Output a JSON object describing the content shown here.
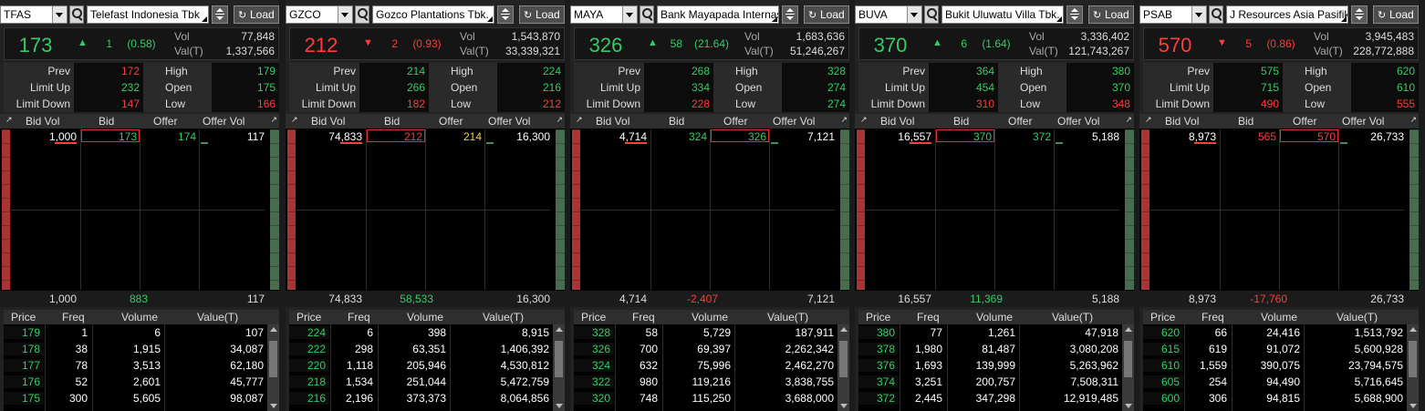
{
  "colors": {
    "up": "#33cc66",
    "down": "#ff3b3b",
    "same": "#e8d040",
    "neutral": "#ffffff",
    "label": "#aaaaaa"
  },
  "labels": {
    "load": "Load",
    "vol": "Vol",
    "val": "Val(T)",
    "prev": "Prev",
    "high": "High",
    "limit_up": "Limit Up",
    "open": "Open",
    "limit_down": "Limit Down",
    "low": "Low",
    "bid_vol": "Bid Vol",
    "bid": "Bid",
    "offer": "Offer",
    "offer_vol": "Offer Vol",
    "price": "Price",
    "freq": "Freq",
    "volume": "Volume",
    "value": "Value(T)"
  },
  "icons": {
    "search": "search-icon",
    "load": "refresh-icon",
    "expand": "expand-collapse-icon",
    "dropdown": "chevron-down-icon",
    "resize": "resize-icon"
  },
  "panels": [
    {
      "code": "TFAS",
      "name": "Telefast Indonesia Tbk",
      "direction": "up",
      "last": "173",
      "change": "1",
      "pct": "(0.58)",
      "vol": "77,848",
      "val": "1,337,566",
      "prev": "172",
      "high": "179",
      "limit_up": "232",
      "open": "175",
      "limit_down": "147",
      "low": "166",
      "prev_dir": "down",
      "high_dir": "up",
      "lu_dir": "up",
      "open_dir": "up",
      "ld_dir": "down",
      "low_dir": "down",
      "bid_vol": "1,000",
      "bid": "173",
      "offer": "174",
      "offer_vol": "117",
      "bid_dir": "up",
      "offer_dir": "up",
      "tot_bid": "1,000",
      "tot_diff": "883",
      "tot_offer": "117",
      "diff_dir": "up",
      "trades": [
        {
          "p": "179",
          "f": "1",
          "v": "6",
          "t": "107"
        },
        {
          "p": "178",
          "f": "38",
          "v": "1,915",
          "t": "34,087"
        },
        {
          "p": "177",
          "f": "78",
          "v": "3,513",
          "t": "62,180"
        },
        {
          "p": "176",
          "f": "52",
          "v": "2,601",
          "t": "45,777"
        },
        {
          "p": "175",
          "f": "300",
          "v": "5,605",
          "t": "98,087"
        }
      ],
      "trade_dirs": [
        "up",
        "up",
        "up",
        "up",
        "up"
      ]
    },
    {
      "code": "GZCO",
      "name": "Gozco Plantations Tbk.",
      "direction": "down",
      "last": "212",
      "change": "2",
      "pct": "(0.93)",
      "vol": "1,543,870",
      "val": "33,339,321",
      "prev": "214",
      "high": "224",
      "limit_up": "266",
      "open": "216",
      "limit_down": "182",
      "low": "212",
      "prev_dir": "up",
      "high_dir": "up",
      "lu_dir": "up",
      "open_dir": "up",
      "ld_dir": "down",
      "low_dir": "down",
      "bid_vol": "74,833",
      "bid": "212",
      "offer": "214",
      "offer_vol": "16,300",
      "bid_dir": "down",
      "offer_dir": "same",
      "tot_bid": "74,833",
      "tot_diff": "58,533",
      "tot_offer": "16,300",
      "diff_dir": "up",
      "trades": [
        {
          "p": "224",
          "f": "6",
          "v": "398",
          "t": "8,915"
        },
        {
          "p": "222",
          "f": "298",
          "v": "63,351",
          "t": "1,406,392"
        },
        {
          "p": "220",
          "f": "1,118",
          "v": "205,946",
          "t": "4,530,812"
        },
        {
          "p": "218",
          "f": "1,534",
          "v": "251,044",
          "t": "5,472,759"
        },
        {
          "p": "216",
          "f": "2,196",
          "v": "373,373",
          "t": "8,064,856"
        }
      ],
      "trade_dirs": [
        "up",
        "up",
        "up",
        "up",
        "up"
      ]
    },
    {
      "code": "MAYA",
      "name": "Bank Mayapada Internasional",
      "direction": "up",
      "last": "326",
      "change": "58",
      "pct": "(21.64)",
      "vol": "1,683,636",
      "val": "51,246,267",
      "prev": "268",
      "high": "328",
      "limit_up": "334",
      "open": "274",
      "limit_down": "228",
      "low": "274",
      "prev_dir": "up",
      "high_dir": "up",
      "lu_dir": "up",
      "open_dir": "up",
      "ld_dir": "down",
      "low_dir": "up",
      "bid_vol": "4,714",
      "bid": "324",
      "offer": "326",
      "offer_vol": "7,121",
      "bid_dir": "up",
      "offer_dir": "up",
      "tot_bid": "4,714",
      "tot_diff": "-2,407",
      "tot_offer": "7,121",
      "diff_dir": "down",
      "trades": [
        {
          "p": "328",
          "f": "58",
          "v": "5,729",
          "t": "187,911"
        },
        {
          "p": "326",
          "f": "700",
          "v": "69,397",
          "t": "2,262,342"
        },
        {
          "p": "324",
          "f": "632",
          "v": "75,996",
          "t": "2,462,270"
        },
        {
          "p": "322",
          "f": "980",
          "v": "119,216",
          "t": "3,838,755"
        },
        {
          "p": "320",
          "f": "748",
          "v": "115,250",
          "t": "3,688,000"
        }
      ],
      "trade_dirs": [
        "up",
        "up",
        "up",
        "up",
        "up"
      ]
    },
    {
      "code": "BUVA",
      "name": "Bukit Uluwatu Villa Tbk.",
      "direction": "up",
      "last": "370",
      "change": "6",
      "pct": "(1.64)",
      "vol": "3,336,402",
      "val": "121,743,267",
      "prev": "364",
      "high": "380",
      "limit_up": "454",
      "open": "370",
      "limit_down": "310",
      "low": "348",
      "prev_dir": "up",
      "high_dir": "up",
      "lu_dir": "up",
      "open_dir": "up",
      "ld_dir": "down",
      "low_dir": "down",
      "bid_vol": "16,557",
      "bid": "370",
      "offer": "372",
      "offer_vol": "5,188",
      "bid_dir": "up",
      "offer_dir": "up",
      "tot_bid": "16,557",
      "tot_diff": "11,369",
      "tot_offer": "5,188",
      "diff_dir": "up",
      "trades": [
        {
          "p": "380",
          "f": "77",
          "v": "1,261",
          "t": "47,918"
        },
        {
          "p": "378",
          "f": "1,980",
          "v": "81,487",
          "t": "3,080,208"
        },
        {
          "p": "376",
          "f": "1,693",
          "v": "139,999",
          "t": "5,263,962"
        },
        {
          "p": "374",
          "f": "3,251",
          "v": "200,757",
          "t": "7,508,311"
        },
        {
          "p": "372",
          "f": "2,445",
          "v": "347,298",
          "t": "12,919,485"
        }
      ],
      "trade_dirs": [
        "up",
        "up",
        "up",
        "up",
        "up"
      ]
    },
    {
      "code": "PSAB",
      "name": "J Resources Asia Pasifik",
      "direction": "down",
      "last": "570",
      "change": "5",
      "pct": "(0.86)",
      "vol": "3,945,483",
      "val": "228,772,888",
      "prev": "575",
      "high": "620",
      "limit_up": "715",
      "open": "610",
      "limit_down": "490",
      "low": "555",
      "prev_dir": "up",
      "high_dir": "up",
      "lu_dir": "up",
      "open_dir": "up",
      "ld_dir": "down",
      "low_dir": "down",
      "bid_vol": "8,973",
      "bid": "565",
      "offer": "570",
      "offer_vol": "26,733",
      "bid_dir": "down",
      "offer_dir": "down",
      "tot_bid": "8,973",
      "tot_diff": "-17,760",
      "tot_offer": "26,733",
      "diff_dir": "down",
      "trades": [
        {
          "p": "620",
          "f": "66",
          "v": "24,416",
          "t": "1,513,792"
        },
        {
          "p": "615",
          "f": "619",
          "v": "91,072",
          "t": "5,600,928"
        },
        {
          "p": "610",
          "f": "1,559",
          "v": "390,075",
          "t": "23,794,575"
        },
        {
          "p": "605",
          "f": "254",
          "v": "94,490",
          "t": "5,716,645"
        },
        {
          "p": "600",
          "f": "306",
          "v": "94,815",
          "t": "5,688,900"
        }
      ],
      "trade_dirs": [
        "up",
        "up",
        "up",
        "up",
        "up"
      ]
    }
  ]
}
